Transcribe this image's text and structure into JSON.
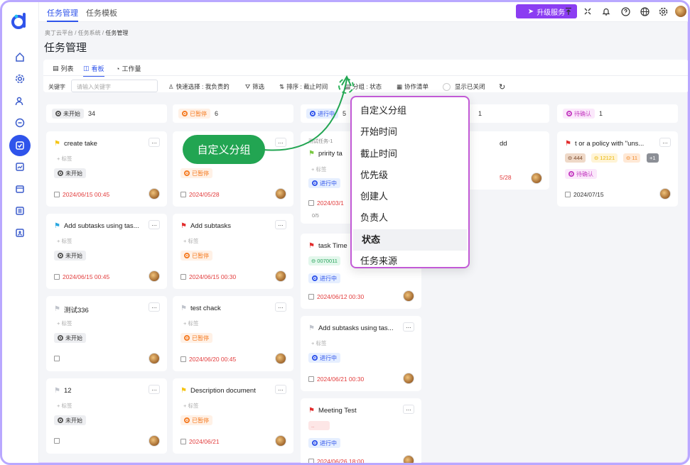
{
  "top": {
    "tabs": [
      "任务管理",
      "任务模板"
    ],
    "upgrade": "升级服务"
  },
  "breadcrumb": [
    "奥丁云平台",
    "任务系统",
    "任务管理"
  ],
  "page_title": "任务管理",
  "view_tabs": [
    "列表",
    "看板",
    "工作量"
  ],
  "toolbar": {
    "keyword_label": "关键字",
    "keyword_placeholder": "请输入关键字",
    "quick": "快速选择 : 我负责的",
    "filter": "筛选",
    "sort": "排序 : 截止时间",
    "group": "分组 : 状态",
    "collab": "协作清单",
    "show_closed": "显示已关闭"
  },
  "callout": "自定义分组",
  "dropdown": {
    "items": [
      "自定义分组",
      "开始时间",
      "截止时间",
      "优先级",
      "创建人",
      "负责人",
      "状态",
      "任务来源"
    ],
    "selected": "状态"
  },
  "add_tag": "+ 标签",
  "columns": [
    {
      "status": "未开始",
      "count": "34",
      "cards": [
        {
          "title": "create take",
          "flag": "#f5c518",
          "status": "未开始",
          "date": "2024/06/15 00:45",
          "date_red": true
        },
        {
          "title": "Add subtasks using tas...",
          "flag": "#2aa7e0",
          "status": "未开始",
          "date": "2024/06/15 00:45",
          "date_red": true
        },
        {
          "title": "测试336",
          "flag": "#c0c4cc",
          "status": "未开始",
          "date": "",
          "date_red": false
        },
        {
          "title": "12",
          "flag": "#c0c4cc",
          "status": "未开始",
          "date": "",
          "date_red": false
        }
      ]
    },
    {
      "status": "已暂停",
      "count": "6",
      "cards": [
        {
          "title": "",
          "flag": "",
          "status": "已暂停",
          "date": "2024/05/28",
          "date_red": true
        },
        {
          "title": "Add subtasks",
          "flag": "#e22d2d",
          "status": "已暂停",
          "date": "2024/06/15 00:30",
          "date_red": true
        },
        {
          "title": "test chack",
          "flag": "#c0c4cc",
          "status": "已暂停",
          "date": "2024/06/20 00:45",
          "date_red": true
        },
        {
          "title": "Description document",
          "flag": "#f5c518",
          "status": "已暂停",
          "date": "2024/06/21",
          "date_red": true
        }
      ]
    },
    {
      "status": "进行中",
      "count": "5",
      "cards": [
        {
          "title": "pririty ta",
          "flag": "#7ac943",
          "status": "进行中",
          "date": "2024/03/1",
          "date_red": true,
          "parent": "测试任务-1",
          "progress": "0/5"
        },
        {
          "title": "task Time",
          "flag": "#e22d2d",
          "status": "进行中",
          "date": "2024/06/12 00:30",
          "date_red": true,
          "chip": "0070011"
        },
        {
          "title": "Add subtasks using tas...",
          "flag": "#c0c4cc",
          "status": "进行中",
          "date": "2024/06/21 00:30",
          "date_red": true
        },
        {
          "title": "Meeting Test",
          "flag": "#e22d2d",
          "status": "进行中",
          "date": "2024/06/26 18:00",
          "date_red": true,
          "chip": ".."
        }
      ]
    },
    {
      "status": "",
      "count": "1",
      "cards": [
        {
          "title": "dd",
          "flag": "",
          "status": "",
          "date": "5/28",
          "date_red": true
        }
      ]
    },
    {
      "status": "待确认",
      "count": "1",
      "cards": [
        {
          "title": "t or a policy with \"uns...",
          "flag": "#e22d2d",
          "status": "待确认",
          "date": "2024/07/15",
          "date_red": false,
          "chips": [
            "444",
            "12121",
            "11",
            "+1"
          ]
        }
      ]
    }
  ]
}
